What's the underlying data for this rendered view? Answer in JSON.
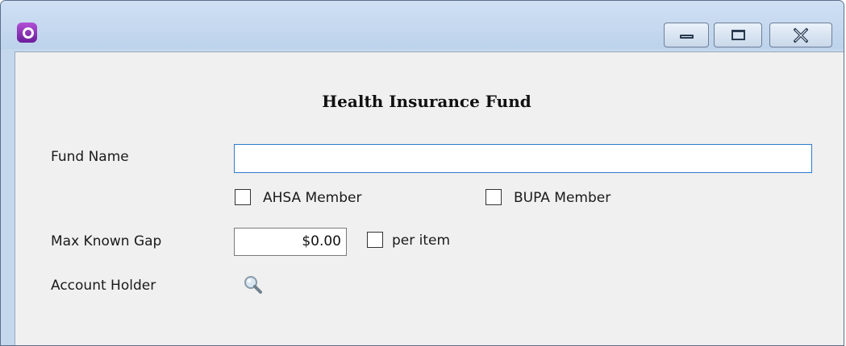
{
  "window": {
    "app_icon": "app-logo-icon",
    "controls": {
      "minimize": "minimize-icon",
      "maximize": "maximize-icon",
      "close_glyph": "ꟷ",
      "close": "close-icon"
    }
  },
  "form": {
    "title": "Health Insurance Fund",
    "fund_name": {
      "label": "Fund Name",
      "value": ""
    },
    "ahsa_member": {
      "label": "AHSA Member",
      "checked": false
    },
    "bupa_member": {
      "label": "BUPA Member",
      "checked": false
    },
    "max_known_gap": {
      "label": "Max Known Gap",
      "value": "$0.00"
    },
    "per_item": {
      "label": "per item",
      "checked": false
    },
    "account_holder": {
      "label": "Account Holder",
      "lookup_icon": "search-icon"
    }
  },
  "colors": {
    "window_frame": "#c4d7ed",
    "client_background": "#f0f0f0",
    "focus_border": "#2e7bcf",
    "app_icon": "#8b2fc0"
  }
}
